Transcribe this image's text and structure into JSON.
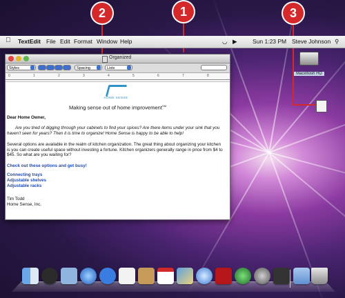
{
  "callouts": {
    "c1": "1",
    "c2": "2",
    "c3": "3"
  },
  "menubar": {
    "apple": "",
    "app": "TextEdit",
    "items": [
      "File",
      "Edit",
      "Format",
      "Window",
      "Help"
    ],
    "clock": "Sun 1:23 PM",
    "user": "Steve Johnson"
  },
  "window": {
    "title": "Organized",
    "toolbar": {
      "styles": "Styles",
      "spacing": "Spacing",
      "lists": "Lists"
    },
    "ruler": [
      "0",
      "1",
      "2",
      "3",
      "4",
      "5",
      "6",
      "7",
      "8"
    ]
  },
  "doc": {
    "logo": "HOME SENSE",
    "tagline": "Making sense out of home improvement",
    "tagline_mark": "SM",
    "salutation": "Dear Home Owner,",
    "p1": "Are you tired of digging through your cabinets to find your spices? Are there items under your sink that you haven't seen for years? Then it is time to organize! Home Sense is happy to be able to help!",
    "p2": "Several options are available in the realm of kitchen organization. The great thing about organizing your kitchen is you can create useful space without investing a fortune. Kitchen organizers generally range in price from $4 to $45. So what are you waiting for?",
    "cta": "Check out these options and get busy!",
    "options": [
      "Connecting trays",
      "Adjustable shelves",
      "Adjustable racks"
    ],
    "sig_name": "Tim Todd",
    "sig_company": "Home Sense, Inc."
  },
  "desktop": {
    "hd_label": "Macintosh HD"
  }
}
